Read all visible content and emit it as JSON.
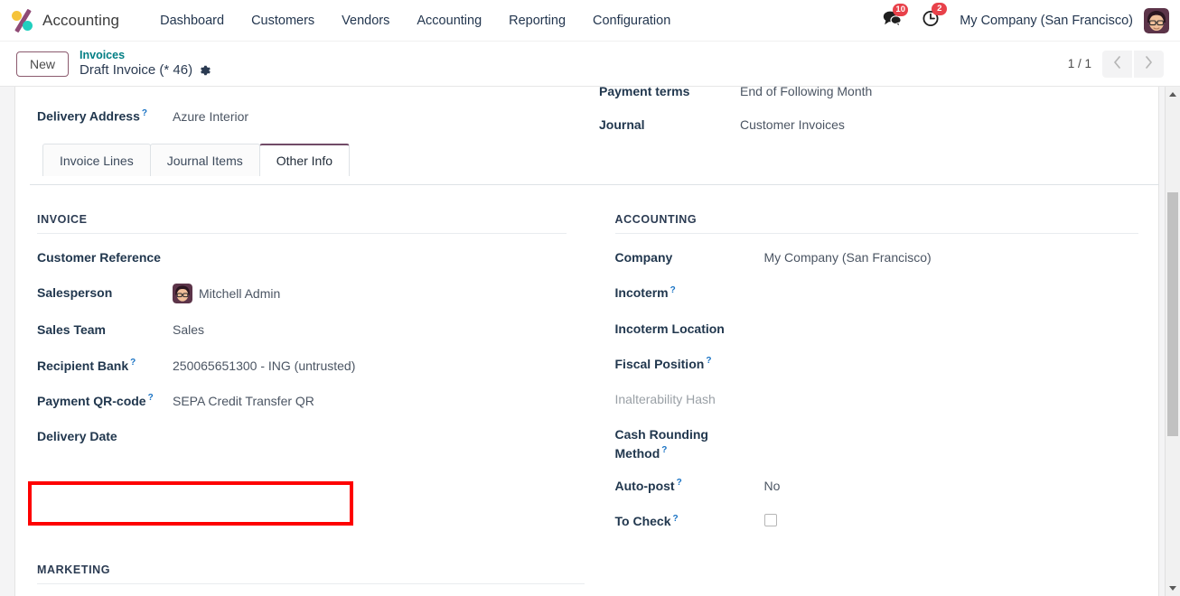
{
  "navbar": {
    "app_icon": "odoo-accounting-logo",
    "brand": "Accounting",
    "menus": [
      {
        "label": "Dashboard"
      },
      {
        "label": "Customers"
      },
      {
        "label": "Vendors"
      },
      {
        "label": "Accounting"
      },
      {
        "label": "Reporting"
      },
      {
        "label": "Configuration"
      }
    ],
    "messages_icon": "messages-icon",
    "messages_count": "10",
    "activities_icon": "activities-clock-icon",
    "activities_count": "2",
    "company": "My Company (San Francisco)",
    "avatar_icon": "user-avatar"
  },
  "control_panel": {
    "new_button": "New",
    "breadcrumb_parent": "Invoices",
    "breadcrumb_current": "Draft Invoice (* 46)",
    "gear_icon": "gear-icon",
    "pager": "1 / 1",
    "prev_icon": "chevron-left-icon",
    "next_icon": "chevron-right-icon"
  },
  "form": {
    "cut_fields": [
      {
        "label": "Delivery Address",
        "help": "?",
        "value": "Azure Interior"
      },
      {
        "label": "Payment terms",
        "help": "",
        "value": "End of Following Month"
      },
      {
        "label": "Journal",
        "help": "",
        "value": "Customer Invoices"
      }
    ],
    "tabs": [
      {
        "label": "Invoice Lines",
        "active": false
      },
      {
        "label": "Journal Items",
        "active": false
      },
      {
        "label": "Other Info",
        "active": true
      }
    ],
    "invoice_section": {
      "title": "INVOICE",
      "fields": [
        {
          "label": "Customer Reference",
          "help": "",
          "value": ""
        },
        {
          "label": "Salesperson",
          "help": "",
          "value": "Mitchell Admin",
          "avatar": "mitchell-admin-avatar"
        },
        {
          "label": "Sales Team",
          "help": "",
          "value": "Sales"
        },
        {
          "label": "Recipient Bank",
          "help": "?",
          "value": "250065651300 - ING (untrusted)"
        },
        {
          "label": "Payment QR-code",
          "help": "?",
          "value": "SEPA Credit Transfer QR"
        },
        {
          "label": "Delivery Date",
          "help": "",
          "value": ""
        }
      ]
    },
    "accounting_section": {
      "title": "ACCOUNTING",
      "fields": [
        {
          "label": "Company",
          "help": "",
          "value": "My Company (San Francisco)"
        },
        {
          "label": "Incoterm",
          "help": "?",
          "value": ""
        },
        {
          "label": "Incoterm Location",
          "help": "",
          "value": ""
        },
        {
          "label": "Fiscal Position",
          "help": "?",
          "value": ""
        },
        {
          "label": "Inalterability Hash",
          "help": "",
          "value": "",
          "muted": true
        },
        {
          "label": "Cash Rounding Method",
          "help": "?",
          "value": ""
        },
        {
          "label": "Auto-post",
          "help": "?",
          "value": "No"
        },
        {
          "label": "To Check",
          "help": "?",
          "value": "",
          "checkbox": true
        }
      ]
    },
    "marketing_section": {
      "title": "MARKETING"
    }
  },
  "annotation": {
    "target": "payment-qr-code-field",
    "color": "#fe0000"
  },
  "scrollbar": {
    "name": "vertical-scrollbar"
  }
}
